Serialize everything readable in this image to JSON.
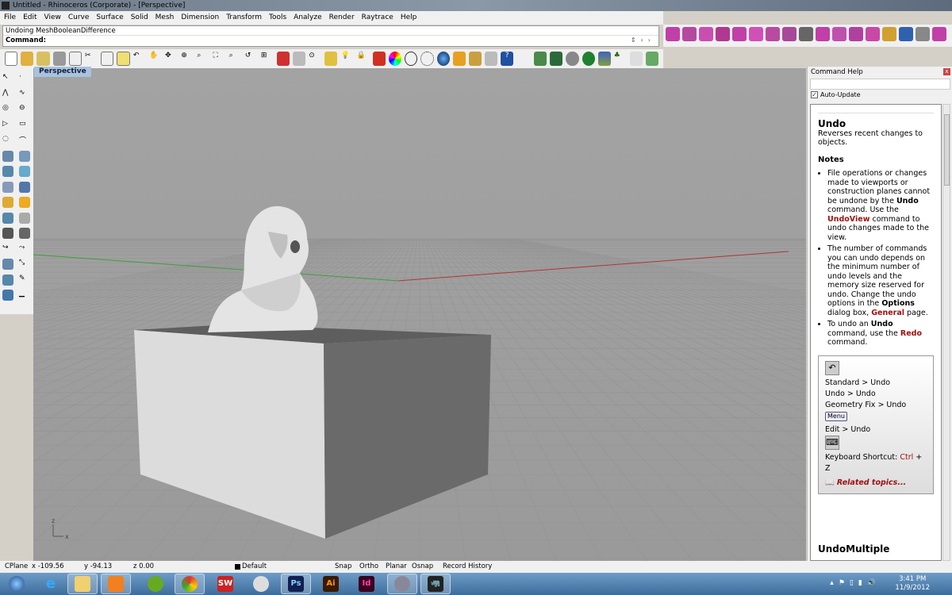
{
  "window": {
    "title": "Untitled - Rhinoceros (Corporate) - [Perspective]"
  },
  "menu": [
    "File",
    "Edit",
    "View",
    "Curve",
    "Surface",
    "Solid",
    "Mesh",
    "Dimension",
    "Transform",
    "Tools",
    "Analyze",
    "Render",
    "Raytrace",
    "Help"
  ],
  "command": {
    "history": "Undoing MeshBooleanDifference",
    "prompt": "Command:",
    "value": ""
  },
  "viewport": {
    "tab": "Perspective",
    "axis_x": "x",
    "axis_z": "z",
    "colors": {
      "background": "#a0a0a0",
      "x_axis": "#b03030",
      "y_axis": "#30a030"
    }
  },
  "panel": {
    "title": "Command Help",
    "close": "x",
    "search": "",
    "auto_update": {
      "label": "Auto-Update",
      "checked": true
    },
    "help": {
      "title": "Undo",
      "summary": "Reverses recent changes to objects.",
      "notes_heading": "Notes",
      "note1": {
        "a": "File operations or changes made to viewports or construction planes cannot be undone by the ",
        "b": "Undo",
        "c": " command. Use the ",
        "d": "UndoView",
        "e": " command to undo changes made to the view."
      },
      "note2": {
        "a": "The number of commands you can undo depends on the minimum number of undo levels and the memory size reserved for undo. Change the undo options in the ",
        "b": "Options",
        "c": " dialog box, ",
        "d": "General",
        "e": " page."
      },
      "note3": {
        "a": "To undo an ",
        "b": "Undo",
        "c": " command, use the ",
        "d": "Redo",
        "e": " command."
      },
      "paths": [
        "Standard > Undo",
        "Undo > Undo",
        "Geometry Fix > Undo"
      ],
      "menu_badge": "Menu",
      "menu_path": "Edit > Undo",
      "shortcut_label": "Keyboard Shortcut: ",
      "shortcut_key": "Ctrl",
      " shortcut_plus": " + Z",
      "related": "Related topics...",
      "next_title": "UndoMultiple"
    }
  },
  "status": {
    "cplane": "CPlane",
    "x": "x -109.56",
    "y": "y -94.13",
    "z": "z 0.00",
    "layer": "Default",
    "snap": "Snap",
    "ortho": "Ortho",
    "planar": "Planar",
    "osnap": "Osnap",
    "record": "Record History"
  },
  "taskbar": {
    "apps": [
      "Start",
      "Internet Explorer",
      "Windows Explorer",
      "Media Player",
      "Spotify",
      "Chrome",
      "SolidWorks",
      "KeyShot",
      "Photoshop",
      "Illustrator",
      "InDesign",
      "Rhino bust",
      "Rhinoceros"
    ],
    "ps": "Ps",
    "ai": "Ai",
    "id": "Id",
    "sw": "SW",
    "time": "3:41 PM",
    "date": "11/9/2012"
  }
}
